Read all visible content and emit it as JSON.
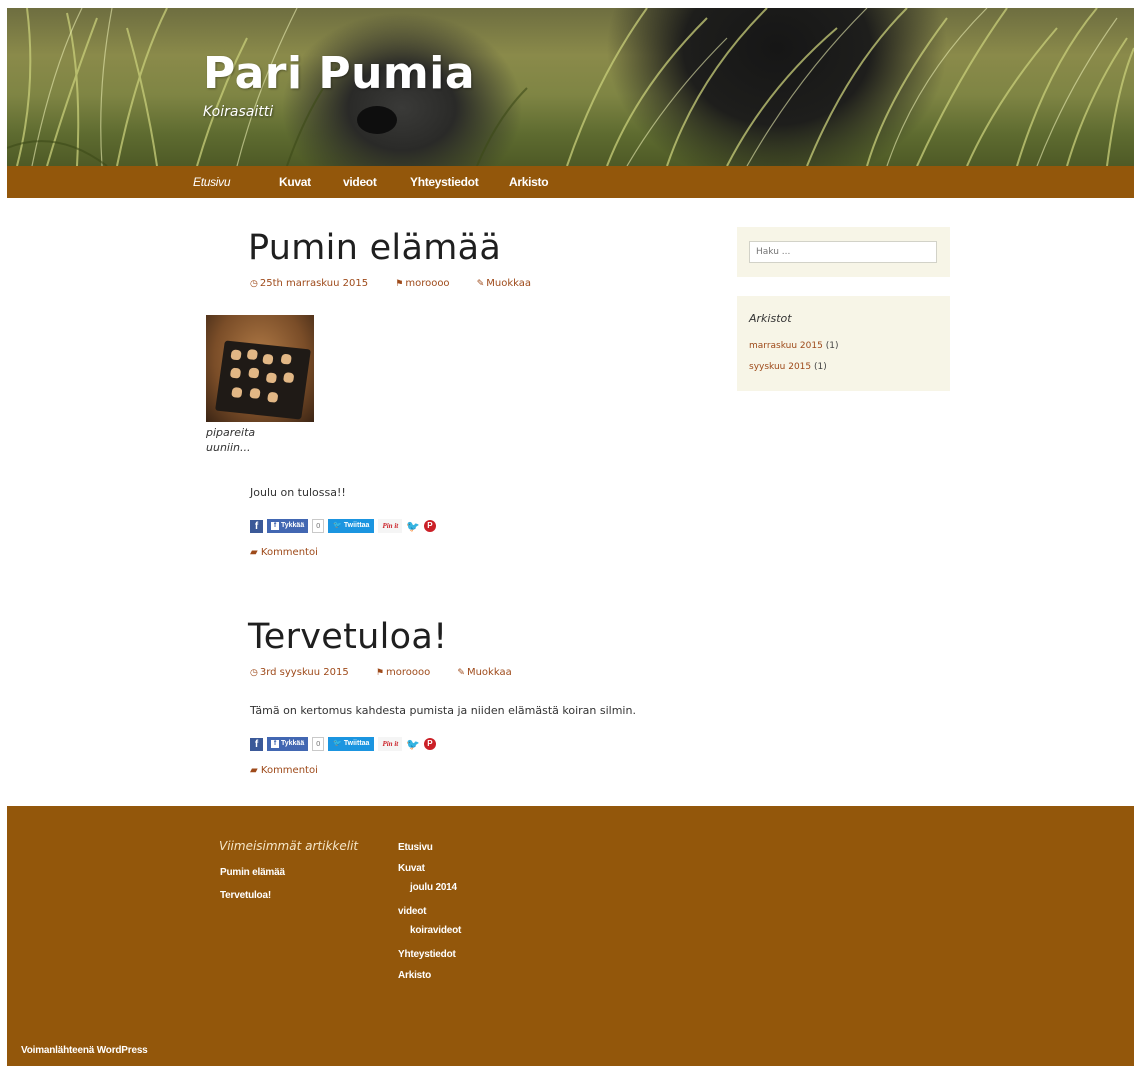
{
  "site": {
    "title": "Pari Pumia",
    "description": "Koirasaitti"
  },
  "nav": {
    "items": [
      "Etusivu",
      "Kuvat",
      "videot",
      "Yhteystiedot",
      "Arkisto"
    ]
  },
  "posts": [
    {
      "title": "Pumin elämää",
      "date": "25th marraskuu 2015",
      "author": "moroooo",
      "edit": "Muokkaa",
      "image_caption": "pipareita uuniin...",
      "text": "Joulu on tulossa!!",
      "share": {
        "like": "Tykkää",
        "count": "0",
        "tweet": "Twiittaa",
        "pin": "Pin it"
      },
      "comment": "Kommentoi"
    },
    {
      "title": "Tervetuloa!",
      "date": "3rd syyskuu 2015",
      "author": "moroooo",
      "edit": "Muokkaa",
      "text": "Tämä on kertomus kahdesta pumista ja niiden elämästä koiran silmin.",
      "share": {
        "like": "Tykkää",
        "count": "0",
        "tweet": "Twiittaa",
        "pin": "Pin it"
      },
      "comment": "Kommentoi"
    }
  ],
  "sidebar": {
    "search_placeholder": "Haku ...",
    "archives_title": "Arkistot",
    "archives": [
      {
        "label": "marraskuu 2015",
        "count": "(1)"
      },
      {
        "label": "syyskuu 2015",
        "count": "(1)"
      }
    ]
  },
  "footer": {
    "recent_title": "Viimeisimmät artikkelit",
    "recent": [
      "Pumin elämää",
      "Tervetuloa!"
    ],
    "menu": [
      {
        "label": "Etusivu",
        "child": false
      },
      {
        "label": "Kuvat",
        "child": false
      },
      {
        "label": "joulu 2014",
        "child": true
      },
      {
        "label": "videot",
        "child": false
      },
      {
        "label": "koiravideot",
        "child": true
      },
      {
        "label": "Yhteystiedot",
        "child": false
      },
      {
        "label": "Arkisto",
        "child": false
      }
    ],
    "powered": "Voimanlähteenä WordPress"
  },
  "colors": {
    "brand": "#93570b",
    "link": "#9e4a1a",
    "widget_bg": "#f7f5e7"
  },
  "icons": {
    "date": "clock-icon",
    "author": "flag-icon",
    "edit": "pencil-icon",
    "comment": "speech-bubble-icon"
  }
}
